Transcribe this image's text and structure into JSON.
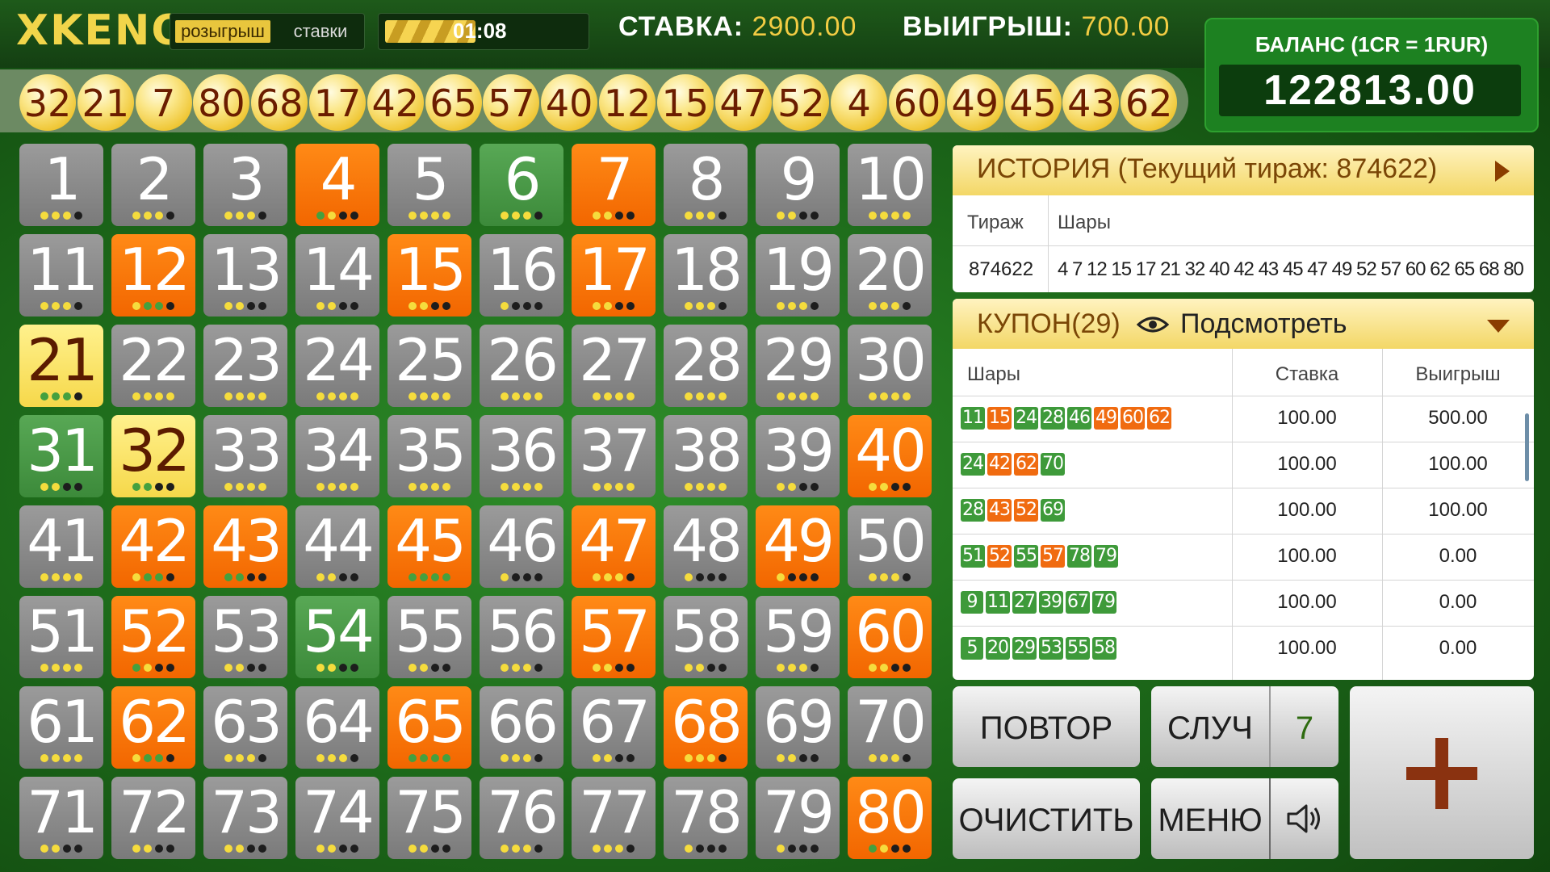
{
  "header": {
    "logo": "XKENO",
    "mode_draw": "розыгрыш",
    "mode_bets": "ставки",
    "timer": "01:08",
    "stake_label": "СТАВКА:",
    "stake_value": "2900.00",
    "win_label": "ВЫИГРЫШ:",
    "win_value": "700.00",
    "balance_label": "БАЛАНС (1CR = 1RUR)",
    "balance_value": "122813.00"
  },
  "drawn_balls": [
    "32",
    "21",
    "7",
    "80",
    "68",
    "17",
    "42",
    "65",
    "57",
    "40",
    "12",
    "15",
    "47",
    "52",
    "4",
    "60",
    "49",
    "45",
    "43",
    "62"
  ],
  "board": {
    "cells": [
      {
        "n": "1",
        "s": "n",
        "d": "yyyb"
      },
      {
        "n": "2",
        "s": "n",
        "d": "yyyb"
      },
      {
        "n": "3",
        "s": "n",
        "d": "yyyb"
      },
      {
        "n": "4",
        "s": "h",
        "d": "gybb"
      },
      {
        "n": "5",
        "s": "n",
        "d": "yyyy"
      },
      {
        "n": "6",
        "s": "g",
        "d": "yyyb"
      },
      {
        "n": "7",
        "s": "h",
        "d": "yybb"
      },
      {
        "n": "8",
        "s": "n",
        "d": "yyyb"
      },
      {
        "n": "9",
        "s": "n",
        "d": "yybb"
      },
      {
        "n": "10",
        "s": "n",
        "d": "yyyy"
      },
      {
        "n": "11",
        "s": "n",
        "d": "yyyb"
      },
      {
        "n": "12",
        "s": "h",
        "d": "yggb"
      },
      {
        "n": "13",
        "s": "n",
        "d": "yybb"
      },
      {
        "n": "14",
        "s": "n",
        "d": "yybb"
      },
      {
        "n": "15",
        "s": "h",
        "d": "yybb"
      },
      {
        "n": "16",
        "s": "n",
        "d": "ybbb"
      },
      {
        "n": "17",
        "s": "h",
        "d": "yybb"
      },
      {
        "n": "18",
        "s": "n",
        "d": "yyyb"
      },
      {
        "n": "19",
        "s": "n",
        "d": "yyyb"
      },
      {
        "n": "20",
        "s": "n",
        "d": "yyyb"
      },
      {
        "n": "21",
        "s": "y",
        "d": "gggb"
      },
      {
        "n": "22",
        "s": "n",
        "d": "yyyy"
      },
      {
        "n": "23",
        "s": "n",
        "d": "yyyy"
      },
      {
        "n": "24",
        "s": "n",
        "d": "yyyy"
      },
      {
        "n": "25",
        "s": "n",
        "d": "yyyy"
      },
      {
        "n": "26",
        "s": "n",
        "d": "yyyy"
      },
      {
        "n": "27",
        "s": "n",
        "d": "yyyy"
      },
      {
        "n": "28",
        "s": "n",
        "d": "yyyy"
      },
      {
        "n": "29",
        "s": "n",
        "d": "yyyy"
      },
      {
        "n": "30",
        "s": "n",
        "d": "yyyy"
      },
      {
        "n": "31",
        "s": "g",
        "d": "yybb"
      },
      {
        "n": "32",
        "s": "y",
        "d": "ggbb"
      },
      {
        "n": "33",
        "s": "n",
        "d": "yyyy"
      },
      {
        "n": "34",
        "s": "n",
        "d": "yyyy"
      },
      {
        "n": "35",
        "s": "n",
        "d": "yyyy"
      },
      {
        "n": "36",
        "s": "n",
        "d": "yyyy"
      },
      {
        "n": "37",
        "s": "n",
        "d": "yyyy"
      },
      {
        "n": "38",
        "s": "n",
        "d": "yyyy"
      },
      {
        "n": "39",
        "s": "n",
        "d": "yybb"
      },
      {
        "n": "40",
        "s": "h",
        "d": "yybb"
      },
      {
        "n": "41",
        "s": "n",
        "d": "yyyy"
      },
      {
        "n": "42",
        "s": "h",
        "d": "yggb"
      },
      {
        "n": "43",
        "s": "h",
        "d": "ggbb"
      },
      {
        "n": "44",
        "s": "n",
        "d": "yybb"
      },
      {
        "n": "45",
        "s": "h",
        "d": "gggg"
      },
      {
        "n": "46",
        "s": "n",
        "d": "ybbb"
      },
      {
        "n": "47",
        "s": "h",
        "d": "yyyb"
      },
      {
        "n": "48",
        "s": "n",
        "d": "ybbb"
      },
      {
        "n": "49",
        "s": "h",
        "d": "ybbb"
      },
      {
        "n": "50",
        "s": "n",
        "d": "yyyb"
      },
      {
        "n": "51",
        "s": "n",
        "d": "yyyy"
      },
      {
        "n": "52",
        "s": "h",
        "d": "gybb"
      },
      {
        "n": "53",
        "s": "n",
        "d": "yybb"
      },
      {
        "n": "54",
        "s": "g",
        "d": "yybb"
      },
      {
        "n": "55",
        "s": "n",
        "d": "yybb"
      },
      {
        "n": "56",
        "s": "n",
        "d": "yyyb"
      },
      {
        "n": "57",
        "s": "h",
        "d": "yybb"
      },
      {
        "n": "58",
        "s": "n",
        "d": "yybb"
      },
      {
        "n": "59",
        "s": "n",
        "d": "yyyb"
      },
      {
        "n": "60",
        "s": "h",
        "d": "yybb"
      },
      {
        "n": "61",
        "s": "n",
        "d": "yyyy"
      },
      {
        "n": "62",
        "s": "h",
        "d": "yggb"
      },
      {
        "n": "63",
        "s": "n",
        "d": "yyyb"
      },
      {
        "n": "64",
        "s": "n",
        "d": "yyyb"
      },
      {
        "n": "65",
        "s": "h",
        "d": "gggg"
      },
      {
        "n": "66",
        "s": "n",
        "d": "yyyb"
      },
      {
        "n": "67",
        "s": "n",
        "d": "yybb"
      },
      {
        "n": "68",
        "s": "h",
        "d": "yyyb"
      },
      {
        "n": "69",
        "s": "n",
        "d": "yybb"
      },
      {
        "n": "70",
        "s": "n",
        "d": "yyyb"
      },
      {
        "n": "71",
        "s": "n",
        "d": "yybb"
      },
      {
        "n": "72",
        "s": "n",
        "d": "yybb"
      },
      {
        "n": "73",
        "s": "n",
        "d": "yybb"
      },
      {
        "n": "74",
        "s": "n",
        "d": "yybb"
      },
      {
        "n": "75",
        "s": "n",
        "d": "yybb"
      },
      {
        "n": "76",
        "s": "n",
        "d": "yyyb"
      },
      {
        "n": "77",
        "s": "n",
        "d": "yyyb"
      },
      {
        "n": "78",
        "s": "n",
        "d": "ybbb"
      },
      {
        "n": "79",
        "s": "n",
        "d": "ybbb"
      },
      {
        "n": "80",
        "s": "h",
        "d": "gybb"
      }
    ]
  },
  "history": {
    "title": "ИСТОРИЯ (Текущий тираж: 874622)",
    "col_draw": "Тираж",
    "col_balls": "Шары",
    "draw": "874622",
    "balls": "4 7 12 15 17 21 32 40 42 43 45 47 49 52 57 60 62 65 68 80"
  },
  "coupon": {
    "title": "КУПОН(29)",
    "peek": "Подсмотреть",
    "col_balls": "Шары",
    "col_stake": "Ставка",
    "col_win": "Выигрыш",
    "rows": [
      {
        "balls": [
          [
            "11",
            "g"
          ],
          [
            "15",
            "o"
          ],
          [
            "24",
            "g"
          ],
          [
            "28",
            "g"
          ],
          [
            "46",
            "g"
          ],
          [
            "49",
            "o"
          ],
          [
            "60",
            "o"
          ],
          [
            "62",
            "o"
          ]
        ],
        "stake": "100.00",
        "win": "500.00"
      },
      {
        "balls": [
          [
            "24",
            "g"
          ],
          [
            "42",
            "o"
          ],
          [
            "62",
            "o"
          ],
          [
            "70",
            "g"
          ]
        ],
        "stake": "100.00",
        "win": "100.00"
      },
      {
        "balls": [
          [
            "28",
            "g"
          ],
          [
            "43",
            "o"
          ],
          [
            "52",
            "o"
          ],
          [
            "69",
            "g"
          ]
        ],
        "stake": "100.00",
        "win": "100.00"
      },
      {
        "balls": [
          [
            "51",
            "g"
          ],
          [
            "52",
            "o"
          ],
          [
            "55",
            "g"
          ],
          [
            "57",
            "o"
          ],
          [
            "78",
            "g"
          ],
          [
            "79",
            "g"
          ]
        ],
        "stake": "100.00",
        "win": "0.00"
      },
      {
        "balls": [
          [
            "9",
            "g"
          ],
          [
            "11",
            "g"
          ],
          [
            "27",
            "g"
          ],
          [
            "39",
            "g"
          ],
          [
            "67",
            "g"
          ],
          [
            "79",
            "g"
          ]
        ],
        "stake": "100.00",
        "win": "0.00"
      },
      {
        "balls": [
          [
            "5",
            "g"
          ],
          [
            "20",
            "g"
          ],
          [
            "29",
            "g"
          ],
          [
            "53",
            "g"
          ],
          [
            "55",
            "g"
          ],
          [
            "58",
            "g"
          ]
        ],
        "stake": "100.00",
        "win": "0.00"
      }
    ]
  },
  "controls": {
    "repeat": "ПОВТОР",
    "random": "СЛУЧ",
    "random_count": "7",
    "clear": "ОЧИСТИТЬ",
    "menu": "МЕНЮ"
  },
  "colors": {
    "hit": "#f26600",
    "accent": "#f2cc43",
    "green_ball": "#3e9a3a",
    "orange_ball": "#f06b10"
  }
}
